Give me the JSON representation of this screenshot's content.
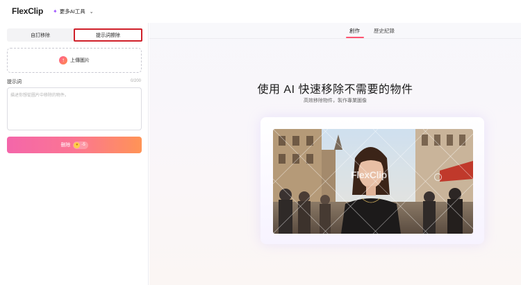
{
  "header": {
    "logo_text": "FlexClip",
    "tools_menu_label": "更多AI工具"
  },
  "left_panel": {
    "tabs": [
      {
        "label": "自訂移除"
      },
      {
        "label": "提示詞擦除"
      }
    ],
    "upload_label": "上傳圖片",
    "prompt": {
      "label": "提示詞",
      "counter": "0/200",
      "placeholder": "描述你想從圖片中移除的物件。"
    },
    "delete_button": {
      "label": "刪除",
      "credits": "-5"
    }
  },
  "main": {
    "tabs": [
      {
        "label": "創作",
        "active": true
      },
      {
        "label": "歷史紀錄",
        "active": false
      }
    ],
    "hero_title": "使用 AI 快速移除不需要的物件",
    "hero_subtitle": "高效移除物件，製作專業圖像",
    "preview_watermark": "FlexClip"
  },
  "colors": {
    "accent": "#ff5470",
    "tab_highlight_border": "#d0202a",
    "button_gradient_start": "#f45aa3",
    "button_gradient_end": "#ff8b48"
  }
}
